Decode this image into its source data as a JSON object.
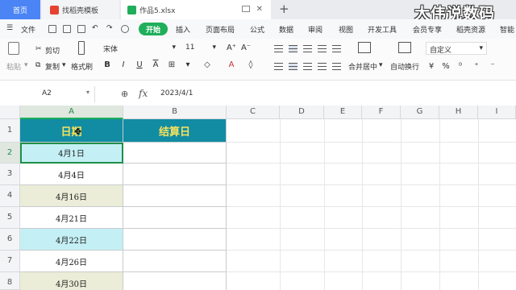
{
  "tabs": {
    "home": "首页",
    "template": "找稻壳模板",
    "document": "作品5.xlsx",
    "add": "+"
  },
  "watermark": "大伟说数码",
  "menu": {
    "file": "文件",
    "start": "开始",
    "items": [
      "插入",
      "页面布局",
      "公式",
      "数据",
      "审阅",
      "视图",
      "开发工具",
      "会员专享",
      "稻壳资源",
      "智能"
    ]
  },
  "ribbon": {
    "cut": "剪切",
    "paste": "粘贴",
    "copy": "复制",
    "format_painter": "格式刷",
    "font_name": "宋体",
    "font_size": "11",
    "merge_center": "合并居中",
    "wrap_text": "自动换行",
    "number_format": "自定义"
  },
  "formula_bar": {
    "cell_ref": "A2",
    "fx": "fx",
    "value": "2023/4/1"
  },
  "columns": [
    "A",
    "B",
    "C",
    "D",
    "E",
    "F",
    "G",
    "H",
    "I"
  ],
  "rows": [
    "1",
    "2",
    "3",
    "4",
    "5",
    "6",
    "7",
    "8"
  ],
  "sheet": {
    "header_a": "日期",
    "header_b": "结算日",
    "dates": [
      "4月1日",
      "4月4日",
      "4月16日",
      "4月21日",
      "4月22日",
      "4月26日",
      "4月30日"
    ]
  },
  "colors": {
    "accent_green": "#1fae5a",
    "header_fill": "#118ca3",
    "header_text": "#f7e25c",
    "cyan_fill": "#c4f0f5",
    "beige_fill": "#ebedd8"
  }
}
